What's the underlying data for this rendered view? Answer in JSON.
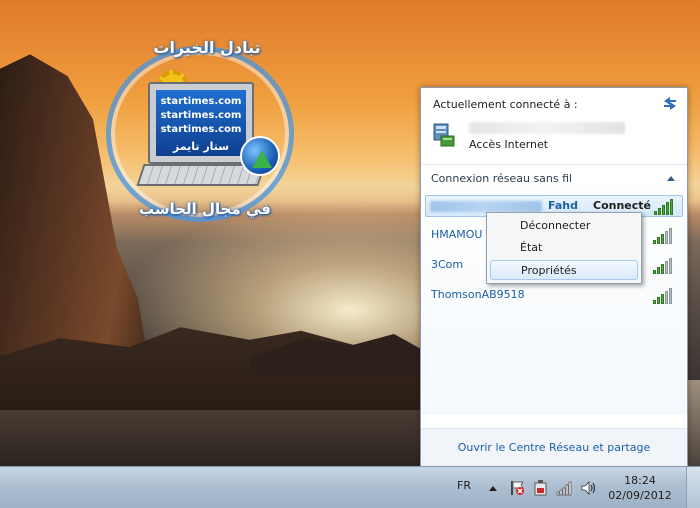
{
  "desktop": {
    "logo": {
      "title": "تبادل الخبرات",
      "lines": [
        "startimes.com",
        "startimes.com",
        "startimes.com",
        "ستار تايمز"
      ],
      "subtitle": "في مجال الحاسب"
    }
  },
  "network_flyout": {
    "header": "Actuellement connecté à :",
    "current_network": {
      "name": "",
      "status": "Accès Internet"
    },
    "wireless_section": {
      "title": "Connexion réseau sans fil",
      "networks": [
        {
          "name": "",
          "tag": "Fahd",
          "state": "Connecté",
          "signal_bars": 5,
          "selected": true
        },
        {
          "name": "HMAMOU",
          "tag": "",
          "state": "",
          "signal_bars": 3,
          "selected": false
        },
        {
          "name": "3Com",
          "tag": "",
          "state": "",
          "signal_bars": 3,
          "selected": false
        },
        {
          "name": "ThomsonAB9518",
          "tag": "",
          "state": "",
          "signal_bars": 3,
          "selected": false
        }
      ]
    },
    "footer_link": "Ouvrir le Centre Réseau et partage"
  },
  "context_menu": {
    "items": [
      {
        "label": "Déconnecter",
        "hovered": false
      },
      {
        "label": "État",
        "hovered": false
      },
      {
        "label": "Propriétés",
        "hovered": true
      }
    ]
  },
  "taskbar": {
    "language": "FR",
    "tray_icons": [
      "show-hidden-icons",
      "action-center-flag-icon",
      "power-icon",
      "network-signal-icon",
      "volume-icon"
    ],
    "clock": {
      "time": "18:24",
      "date": "02/09/2012"
    }
  },
  "colors": {
    "link_blue": "#1d5fa7",
    "signal_green": "#4ea83a",
    "taskbar": "#aebfd2"
  }
}
